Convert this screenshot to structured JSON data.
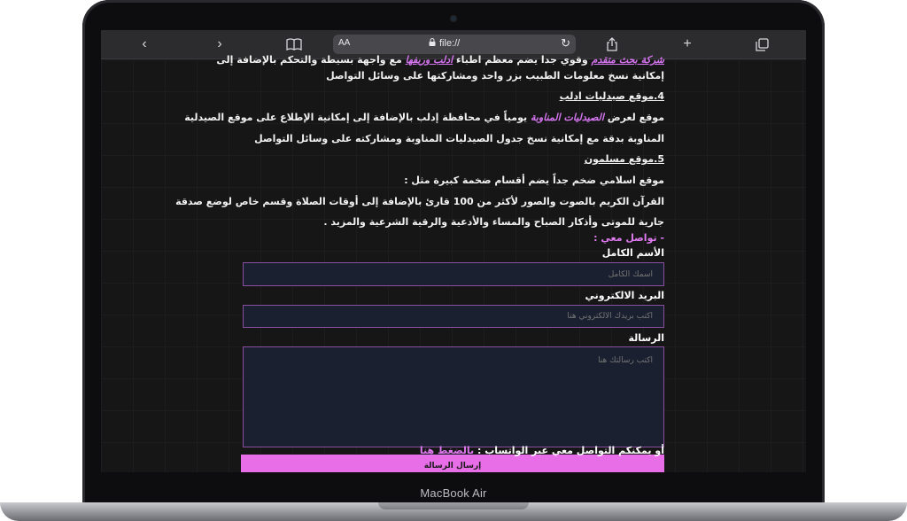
{
  "device": {
    "brand": "MacBook Air"
  },
  "browser": {
    "address_aa": "AA",
    "url": "file://"
  },
  "content": {
    "line0_pre": "",
    "line0_hl1": "شركة بحث متقدم",
    "line0_mid": " وقوي جدا يضم معظم اطباء ",
    "line0_hl2": "ادلب وريفها",
    "line0_post": " مع واجهة بسيطة والتحكم بالإضافة إلى",
    "line1": "إمكانية نسخ معلومات الطبيب بزر واحد ومشاركتها على وسائل التواصل",
    "h4": "4.موقع صيدليات ادلب",
    "line2_pre": "موقع لعرض ",
    "line2_hl": "الصيدليات المناوبة",
    "line2_post": " يومياً في محافظة إدلب بالإضافة إلى إمكانية الإطلاع على موقع الصيدلية",
    "line3": "المناوبة بدقة مع إمكانية نسخ جدول الصيدليات المناوبة ومشاركته على وسائل التواصل",
    "h5": "5.موقع مسلمون",
    "line4": "موقع اسلامي ضخم جداً يضم أقسام ضخمة كبيرة مثل :",
    "line5": "القرآن الكريم بالصوت والصور لأكثر من 100 قارئ بالإضافة إلى أوقات الصلاة وقسم خاص لوضع صدقة",
    "line6": "جارية للموتى وأذكار الصباح والمساء والأدعية والرقية الشرعية والمزيد .",
    "contact_heading": "- تواصل معي :"
  },
  "form": {
    "name_label": "الأسم الكامل",
    "name_placeholder": "اسمك الكامل",
    "email_label": "البريد الالكتروني",
    "email_placeholder": "اكتب بريدك الالكتروني هنا",
    "message_label": "الرسالة",
    "message_placeholder": "اكتب رسالتك هنا",
    "submit_label": "إرسال الرسالة"
  },
  "whatsapp": {
    "text": "أو يمكنكم التواصل معي عبر الواتساب : ",
    "link": "بالضغط هنا"
  },
  "colors": {
    "accent": "#e86ee8",
    "highlight_text": "#d575f0",
    "field_bg": "#1a2030",
    "field_border": "#8a4fa0",
    "page_bg": "#161617"
  }
}
